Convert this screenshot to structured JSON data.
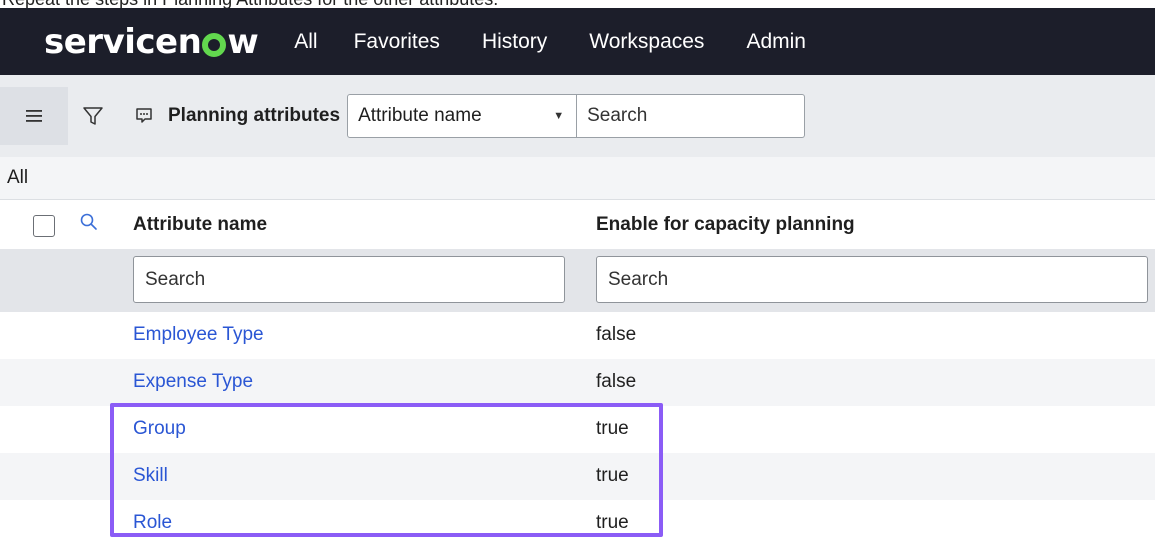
{
  "caption": "Repeat the steps in Planning Attributes for the other attributes.",
  "nav": {
    "logo_left": "servicen",
    "logo_right": "w",
    "items": [
      "All",
      "Favorites",
      "History",
      "Workspaces",
      "Admin"
    ]
  },
  "toolbar": {
    "menu_icon": "hamburger-icon",
    "filter_icon": "filter-funnel-icon",
    "chat_icon": "chat-bubble-icon",
    "title": "Planning attributes",
    "select_value": "Attribute name",
    "search_placeholder": "Search"
  },
  "breadcrumb": "All",
  "columns": {
    "name": "Attribute name",
    "enable": "Enable for capacity planning",
    "name_search_placeholder": "Search",
    "enable_search_placeholder": "Search"
  },
  "rows": [
    {
      "name": "Employee Type",
      "value": "false"
    },
    {
      "name": "Expense Type",
      "value": "false"
    },
    {
      "name": "Group",
      "value": "true"
    },
    {
      "name": "Skill",
      "value": "true"
    },
    {
      "name": "Role",
      "value": "true"
    }
  ],
  "colors": {
    "nav_bg": "#1c1e2a",
    "logo_accent": "#62d84e",
    "link": "#2a56d4",
    "highlight": "#8b5cf6"
  }
}
